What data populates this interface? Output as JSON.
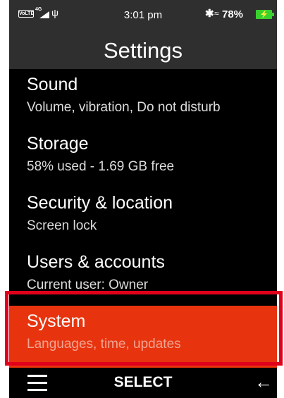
{
  "status_bar": {
    "volte": "VoLTE",
    "network_type": "4G",
    "time": "3:01 pm",
    "battery": "78%",
    "icons": [
      "signal-icon",
      "usb-icon",
      "bluetooth-icon",
      "wifi-icon",
      "battery-charging-icon"
    ]
  },
  "header": {
    "title": "Settings"
  },
  "items": [
    {
      "title": "Sound",
      "subtitle": "Volume, vibration, Do not disturb"
    },
    {
      "title": "Storage",
      "subtitle": "58% used - 1.69 GB free"
    },
    {
      "title": "Security & location",
      "subtitle": "Screen lock"
    },
    {
      "title": "Users & accounts",
      "subtitle": "Current user: Owner"
    },
    {
      "title": "System",
      "subtitle": "Languages, time, updates",
      "selected": true
    }
  ],
  "softkeys": {
    "left_icon": "menu-icon",
    "center": "SELECT",
    "right_icon": "back-arrow-icon"
  },
  "colors": {
    "selected_bg": "#e8340e",
    "highlight_border": "#e0001b",
    "bar_bg": "#2f2f2f"
  }
}
